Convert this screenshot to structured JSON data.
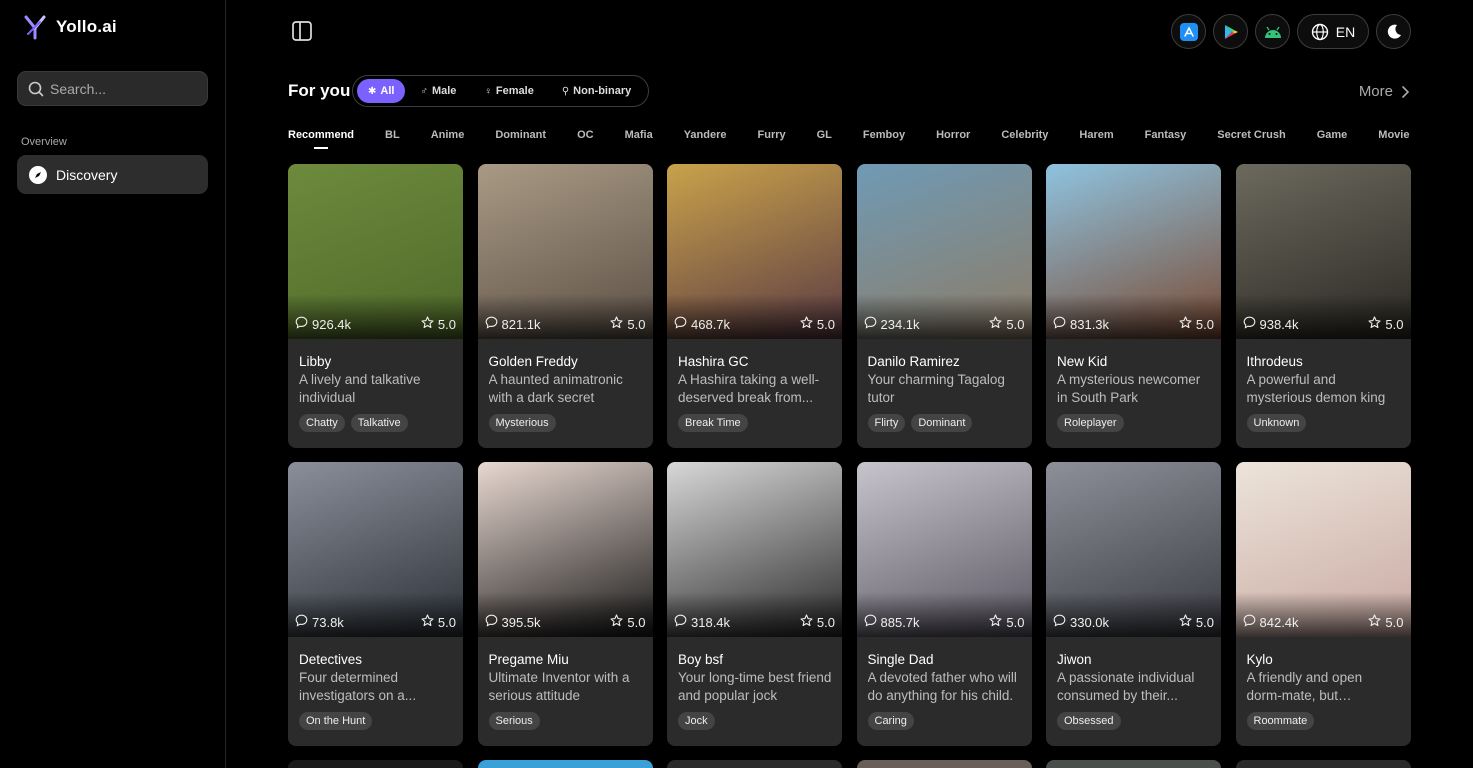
{
  "brand": {
    "name": "Yollo.ai",
    "accent": "#7b61ff"
  },
  "sidebar": {
    "search_placeholder": "Search...",
    "section_label": "Overview",
    "items": [
      {
        "label": "Discovery",
        "icon": "compass-icon"
      }
    ]
  },
  "topbar": {
    "language": "EN"
  },
  "feed": {
    "heading": "For you",
    "genders": [
      {
        "label": "All",
        "symbol": "✱"
      },
      {
        "label": "Male",
        "symbol": "♂"
      },
      {
        "label": "Female",
        "symbol": "♀"
      },
      {
        "label": "Non-binary",
        "symbol": "⚲"
      }
    ],
    "more_label": "More",
    "tabs": [
      "Recommend",
      "BL",
      "Anime",
      "Dominant",
      "OC",
      "Mafia",
      "Yandere",
      "Furry",
      "GL",
      "Femboy",
      "Horror",
      "Celebrity",
      "Harem",
      "Fantasy",
      "Secret Crush",
      "Game",
      "Movie"
    ]
  },
  "cards": [
    {
      "name": "Libby",
      "desc": "A lively and talkative individual",
      "chats": "926.4k",
      "rating": "5.0",
      "tags": [
        "Chatty",
        "Talkative"
      ],
      "colors": [
        "#6e8a3c",
        "#4f6a2a"
      ]
    },
    {
      "name": "Golden Freddy",
      "desc": "A haunted animatronic with a dark secret",
      "chats": "821.1k",
      "rating": "5.0",
      "tags": [
        "Mysterious"
      ],
      "colors": [
        "#a99a84",
        "#5c5046"
      ]
    },
    {
      "name": "Hashira GC",
      "desc": "A Hashira taking a well-deserved break from...",
      "chats": "468.7k",
      "rating": "5.0",
      "tags": [
        "Break Time"
      ],
      "colors": [
        "#c9a24a",
        "#5a3a44"
      ]
    },
    {
      "name": "Danilo Ramirez",
      "desc": "Your charming Tagalog tutor",
      "chats": "234.1k",
      "rating": "5.0",
      "tags": [
        "Flirty",
        "Dominant"
      ],
      "colors": [
        "#6f9ab5",
        "#8d7c66"
      ]
    },
    {
      "name": "New Kid",
      "desc": "A mysterious newcomer in South Park",
      "chats": "831.3k",
      "rating": "5.0",
      "tags": [
        "Roleplayer"
      ],
      "colors": [
        "#8ec3e0",
        "#7a4a32"
      ]
    },
    {
      "name": "Ithrodeus",
      "desc": "A powerful and mysterious demon king",
      "chats": "938.4k",
      "rating": "5.0",
      "tags": [
        "Unknown"
      ],
      "colors": [
        "#6c6a5e",
        "#2a2822"
      ]
    },
    {
      "name": "Detectives",
      "desc": "Four determined investigators on a...",
      "chats": "73.8k",
      "rating": "5.0",
      "tags": [
        "On the Hunt"
      ],
      "colors": [
        "#8a8f9a",
        "#2d3138"
      ]
    },
    {
      "name": "Pregame Miu",
      "desc": "Ultimate Inventor with a serious attitude",
      "chats": "395.5k",
      "rating": "5.0",
      "tags": [
        "Serious"
      ],
      "colors": [
        "#e8d8d0",
        "#1a1a1a"
      ]
    },
    {
      "name": "Boy bsf",
      "desc": "Your long-time best friend and popular jock",
      "chats": "318.4k",
      "rating": "5.0",
      "tags": [
        "Jock"
      ],
      "colors": [
        "#d8d8d8",
        "#2a2a2a"
      ]
    },
    {
      "name": "Single Dad",
      "desc": "A devoted father who will do anything for his child.",
      "chats": "885.7k",
      "rating": "5.0",
      "tags": [
        "Caring"
      ],
      "colors": [
        "#c8c4cc",
        "#5a5662"
      ]
    },
    {
      "name": "Jiwon",
      "desc": "A passionate individual consumed by their...",
      "chats": "330.0k",
      "rating": "5.0",
      "tags": [
        "Obsessed"
      ],
      "colors": [
        "#8d9099",
        "#3a3c42"
      ]
    },
    {
      "name": "Kylo",
      "desc": "A friendly and open dorm-mate, but something...",
      "chats": "842.4k",
      "rating": "5.0",
      "tags": [
        "Roommate"
      ],
      "colors": [
        "#ece4da",
        "#c9a9a2"
      ]
    }
  ],
  "partial_colors": [
    "#1a1a1a",
    "#3aa0d8",
    "#2a2a2a",
    "#6a5f58",
    "#4a4e4a",
    "#2a2a2a"
  ]
}
